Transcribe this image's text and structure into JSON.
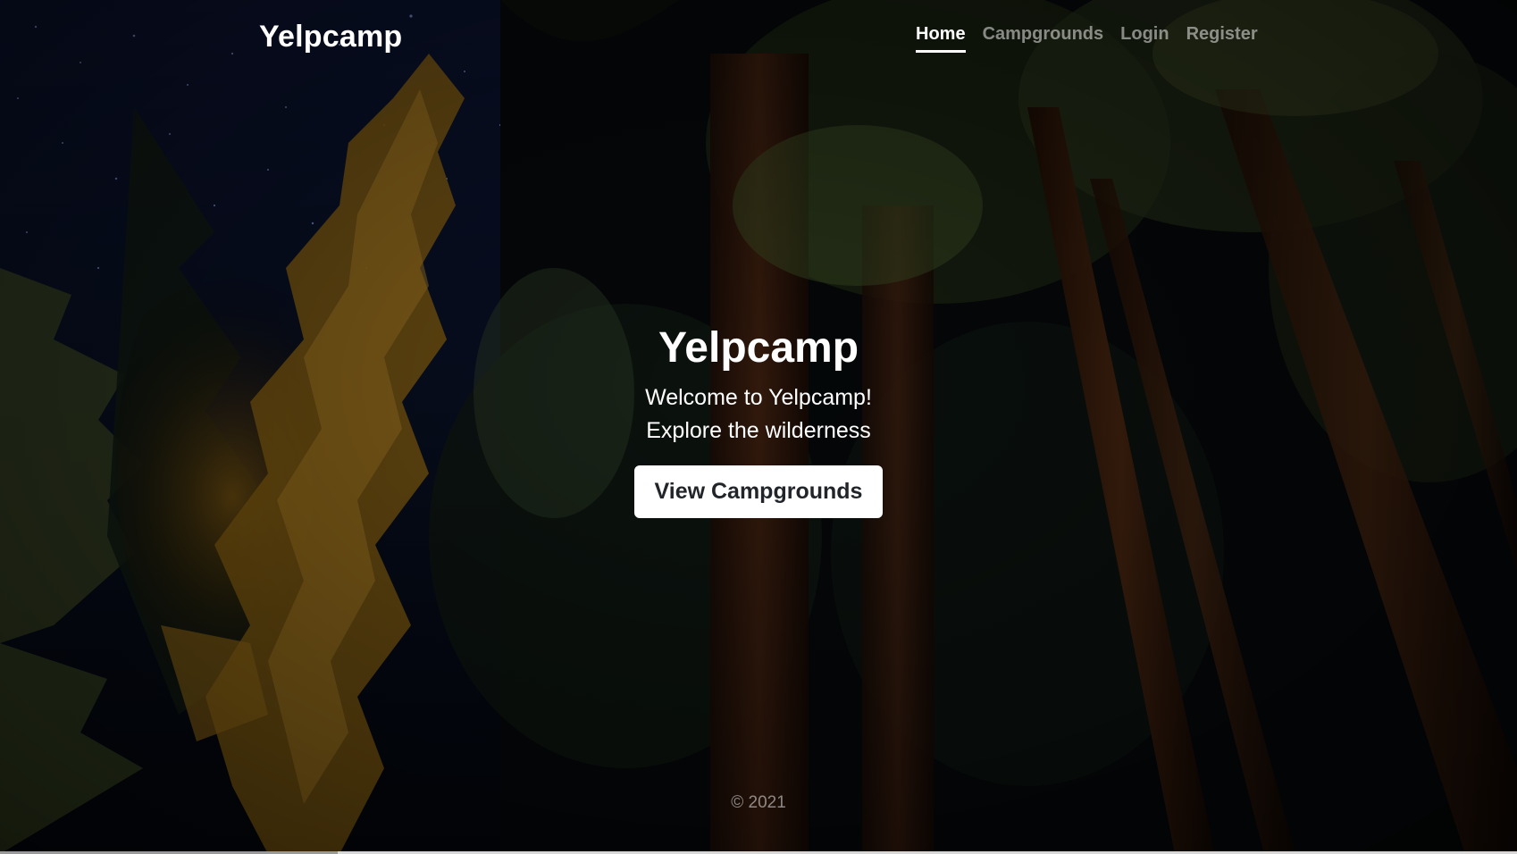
{
  "header": {
    "brand": "Yelpcamp",
    "nav": [
      {
        "label": "Home",
        "active": true
      },
      {
        "label": "Campgrounds",
        "active": false
      },
      {
        "label": "Login",
        "active": false
      },
      {
        "label": "Register",
        "active": false
      }
    ]
  },
  "hero": {
    "title": "Yelpcamp",
    "line1": "Welcome to Yelpcamp!",
    "line2": "Explore the wilderness",
    "button_label": "View Campgrounds"
  },
  "footer": {
    "copyright": "© 2021"
  },
  "colors": {
    "text": "#ffffff",
    "muted_text": "rgba(255,255,255,0.5)",
    "button_bg": "#ffffff",
    "button_text": "#212529"
  },
  "background": {
    "description_icon": "night-forest-background"
  }
}
